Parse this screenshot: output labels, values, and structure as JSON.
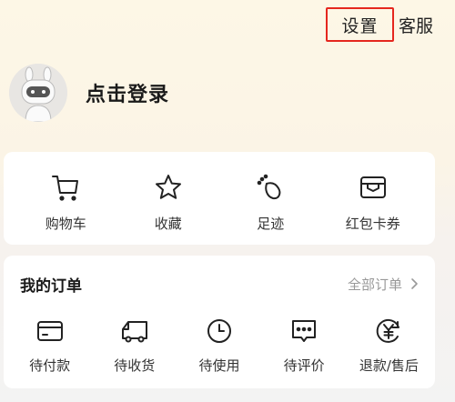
{
  "header": {
    "settings_label": "设置",
    "service_label": "客服"
  },
  "profile": {
    "login_label": "点击登录",
    "avatar_icon": "robot-avatar-icon"
  },
  "tools": [
    {
      "label": "购物车",
      "icon": "cart-icon"
    },
    {
      "label": "收藏",
      "icon": "star-icon"
    },
    {
      "label": "足迹",
      "icon": "footprint-icon"
    },
    {
      "label": "红包卡券",
      "icon": "coupon-wallet-icon"
    }
  ],
  "orders": {
    "title": "我的订单",
    "all_label": "全部订单",
    "items": [
      {
        "label": "待付款",
        "icon": "card-payment-icon"
      },
      {
        "label": "待收货",
        "icon": "truck-icon"
      },
      {
        "label": "待使用",
        "icon": "clock-icon"
      },
      {
        "label": "待评价",
        "icon": "chat-bubble-icon"
      },
      {
        "label": "退款/售后",
        "icon": "yen-refund-icon"
      }
    ]
  },
  "colors": {
    "highlight_border": "#e5271f",
    "card_bg": "#ffffff",
    "muted_text": "#999999"
  }
}
